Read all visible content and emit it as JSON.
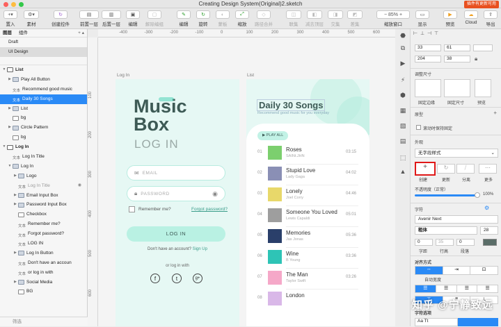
{
  "window": {
    "title": "Creating Design System(Original)2.sketch",
    "badge": "插件有更新可用"
  },
  "toolbar": {
    "insert": "置入",
    "symbols": "素材",
    "create_symbol": "创建控件",
    "forward": "前置一层",
    "backward": "后置一层",
    "edit": "编辑",
    "detach": "解除编组",
    "edit2": "编辑",
    "rotate": "旋转",
    "mask": "蒙板",
    "scale": "缩放",
    "path_ops": "路径合并",
    "union": "联集",
    "subtract": "减去顶层",
    "intersect": "交集",
    "difference": "差集",
    "zoom_label": "缩放窗口",
    "zoom_value": "85%",
    "view": "显示",
    "preview": "预览",
    "cloud": "Cloud",
    "export": "导出"
  },
  "rulers": {
    "h": [
      "-400",
      "-300",
      "-200",
      "-100",
      "0",
      "100",
      "200",
      "300",
      "400",
      "500",
      "600",
      "700"
    ],
    "v": [
      "100",
      "200",
      "300",
      "400",
      "500",
      "600"
    ]
  },
  "layers": {
    "tab_pages": "图层",
    "tab_components": "组件",
    "pages": [
      "Draft",
      "UI Design"
    ],
    "rows": [
      {
        "label": "List",
        "type": "artboard",
        "indent": 0,
        "open": true
      },
      {
        "label": "Play All Button",
        "type": "folder",
        "indent": 1,
        "open": false
      },
      {
        "label": "Recommend good music",
        "type": "text",
        "indent": 1
      },
      {
        "label": "Daily 30 Songs",
        "type": "text",
        "indent": 1,
        "selected": true
      },
      {
        "label": "List",
        "type": "folder",
        "indent": 1,
        "open": false
      },
      {
        "label": "bg",
        "type": "shape",
        "indent": 1
      },
      {
        "label": "Circle Pattern",
        "type": "folder",
        "indent": 1,
        "open": false
      },
      {
        "label": "bg",
        "type": "shape",
        "indent": 1
      },
      {
        "label": "Log In",
        "type": "artboard",
        "indent": 0,
        "open": true
      },
      {
        "label": "Log In Title",
        "type": "text",
        "indent": 1
      },
      {
        "label": "Log In",
        "type": "folder",
        "indent": 1,
        "open": true
      },
      {
        "label": "Logo",
        "type": "folder",
        "indent": 2,
        "open": false
      },
      {
        "label": "Log In Title",
        "type": "text",
        "indent": 2,
        "hidden": true
      },
      {
        "label": "Email Input Box",
        "type": "folder",
        "indent": 2,
        "open": false
      },
      {
        "label": "Password Input Box",
        "type": "folder",
        "indent": 2,
        "open": false
      },
      {
        "label": "Checkbox",
        "type": "shape",
        "indent": 2
      },
      {
        "label": "Remember me?",
        "type": "text",
        "indent": 2
      },
      {
        "label": "Forgot password?",
        "type": "text",
        "indent": 2
      },
      {
        "label": "LOG IN",
        "type": "text",
        "indent": 2
      },
      {
        "label": "Log In Button",
        "type": "folder",
        "indent": 2,
        "open": false
      },
      {
        "label": "Don't have an accoun",
        "type": "text",
        "indent": 2
      },
      {
        "label": "or log in with",
        "type": "text",
        "indent": 2
      },
      {
        "label": "Social Media",
        "type": "folder",
        "indent": 2,
        "open": false
      },
      {
        "label": "BG",
        "type": "shape",
        "indent": 2
      }
    ],
    "text_tag": "文本",
    "filter": "筛选"
  },
  "login": {
    "artboard_label": "Log In",
    "title_music": "Music",
    "title_box": "Box",
    "subtitle": "LOG IN",
    "email_placeholder": "EMAIL",
    "password_placeholder": "PASSWORD",
    "remember": "Remember me?",
    "forgot": "Forgot password?",
    "login_btn": "LOG IN",
    "no_account": "Don't have an account?",
    "signup": "Sign Up",
    "or_login": "or log in with"
  },
  "list": {
    "artboard_label": "List",
    "title": "Daily 30 Songs",
    "subtitle": "Recommend good music for you everyday",
    "play_all": "PLAY ALL",
    "songs": [
      {
        "no": "01",
        "title": "Roses",
        "artist": "SAINt.JHN",
        "time": "03:15",
        "color": "#7ccf6e"
      },
      {
        "no": "02",
        "title": "Stupid Love",
        "artist": "Lady Gaga",
        "time": "04:02",
        "color": "#8a8fb5"
      },
      {
        "no": "03",
        "title": "Lonely",
        "artist": "Joel Corry",
        "time": "04:46",
        "color": "#e8d86a"
      },
      {
        "no": "04",
        "title": "Someone You Loved",
        "artist": "Lewis Capaldi",
        "time": "05:01",
        "color": "#9e9e9e"
      },
      {
        "no": "05",
        "title": "Memories",
        "artist": "Jas Jonas",
        "time": "05:36",
        "color": "#2a3f6a"
      },
      {
        "no": "06",
        "title": "Wine",
        "artist": "B Young",
        "time": "03:36",
        "color": "#2ec4b6"
      },
      {
        "no": "07",
        "title": "The Man",
        "artist": "Taylor Swift",
        "time": "03:26",
        "color": "#f5a8c8"
      },
      {
        "no": "08",
        "title": "London",
        "artist": "",
        "time": "",
        "color": "#d9b8e8"
      }
    ]
  },
  "inspector": {
    "x": "33",
    "y": "61",
    "w": "204",
    "h": "38",
    "resize_title": "调整尺寸",
    "pin_edge": "固定边缘",
    "fix_size": "固定尺寸",
    "preview": "预览",
    "prototype": "原型",
    "fix_scroll": "滚动时保持固定",
    "appearance": "外观",
    "no_style": "无字段样式",
    "create": "创建",
    "update": "更新",
    "detach": "分离",
    "more": "更多",
    "opacity_label": "不透明度（正常）",
    "opacity_value": "100%",
    "font_section": "字符",
    "font_name": "Avenir Next",
    "weight": "粗体",
    "size": "28",
    "char_label": "字距",
    "line_label": "行高",
    "para_label": "段落",
    "char_val": "0",
    "line_val": "35",
    "para_val": "0",
    "align_title": "对齐方式",
    "auto_width": "自动宽度",
    "char_opts": "字符选项",
    "aa": "Aa Tt"
  },
  "watermark": "知乎 @宁静致远"
}
